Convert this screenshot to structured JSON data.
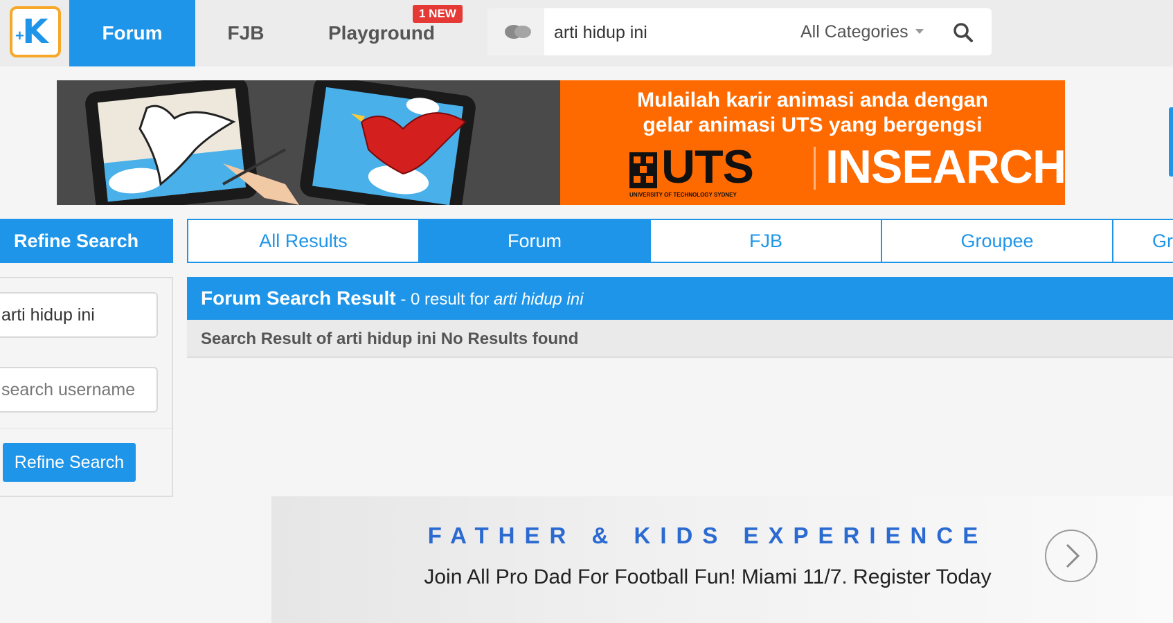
{
  "nav": {
    "tabs": [
      {
        "label": "Forum"
      },
      {
        "label": "FJB"
      },
      {
        "label": "Playground"
      }
    ],
    "playground_badge": "1 NEW"
  },
  "search": {
    "value": "arti hidup ini",
    "category": "All Categories",
    "icons": {
      "chat": "chat-bubbles-icon",
      "search": "search-icon",
      "caret": "chevron-down-icon"
    }
  },
  "banner": {
    "line1": "Mulailah karir animasi anda dengan",
    "line2": "gelar animasi UTS yang bergengsi",
    "brand_left": "UTS",
    "brand_right": "INSEARCH",
    "brand_sub": "UNIVERSITY OF TECHNOLOGY SYDNEY",
    "colors": {
      "orange": "#ff6a00",
      "dark": "#4a4a4a"
    }
  },
  "refine": {
    "header": "Refine Search",
    "keyword_value": "arti hidup ini",
    "username_placeholder": "search username",
    "button_label": "Refine Search"
  },
  "result_tabs": [
    {
      "label": "All Results"
    },
    {
      "label": "Forum"
    },
    {
      "label": "FJB"
    },
    {
      "label": "Groupee"
    },
    {
      "label": "Gr"
    }
  ],
  "results": {
    "title": "Forum Search Result",
    "summary_prefix": "- 0 result for ",
    "query": "arti hidup ini",
    "message": "Search Result of arti hidup ini No Results found"
  },
  "ad": {
    "title": "FATHER & KIDS EXPERIENCE",
    "text": "Join All Pro Dad For Football Fun! Miami 11/7. Register Today"
  },
  "theme": {
    "primary": "#1e95e8",
    "badge": "#e53935",
    "logo_border": "#f7a829"
  }
}
